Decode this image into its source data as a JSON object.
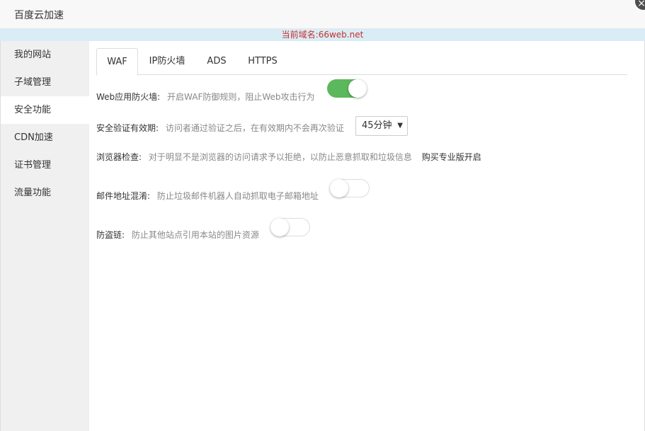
{
  "window": {
    "title": "百度云加速",
    "close_glyph": "×"
  },
  "domain_bar": {
    "text": "当前域名:66web.net",
    "color": "#c9302c"
  },
  "sidebar": {
    "items": [
      {
        "label": "我的网站"
      },
      {
        "label": "子域管理"
      },
      {
        "label": "安全功能",
        "active": true
      },
      {
        "label": "CDN加速"
      },
      {
        "label": "证书管理"
      },
      {
        "label": "流量功能"
      }
    ]
  },
  "tabs": [
    {
      "label": "WAF",
      "active": true
    },
    {
      "label": "IP防火墙"
    },
    {
      "label": "ADS"
    },
    {
      "label": "HTTPS"
    }
  ],
  "settings": {
    "waf": {
      "label": "Web应用防火墙:",
      "desc": "开启WAF防御规则，阻止Web攻击行为",
      "enabled": true
    },
    "verify": {
      "label": "安全验证有效期:",
      "desc": "访问者通过验证之后，在有效期内不会再次验证",
      "selected": "45分钟"
    },
    "browser": {
      "label": "浏览器检查:",
      "desc": "对于明显不是浏览器的访问请求予以拒绝，以防止恶意抓取和垃圾信息",
      "link": "购买专业版开启"
    },
    "email": {
      "label": "邮件地址混淆:",
      "desc": "防止垃圾邮件机器人自动抓取电子邮箱地址",
      "enabled": false
    },
    "hotlink": {
      "label": "防盗链:",
      "desc": "防止其他站点引用本站的图片资源",
      "enabled": false
    }
  },
  "colors": {
    "switch_on": "#5cb85c",
    "domain_bar_bg": "#d9edf7"
  }
}
